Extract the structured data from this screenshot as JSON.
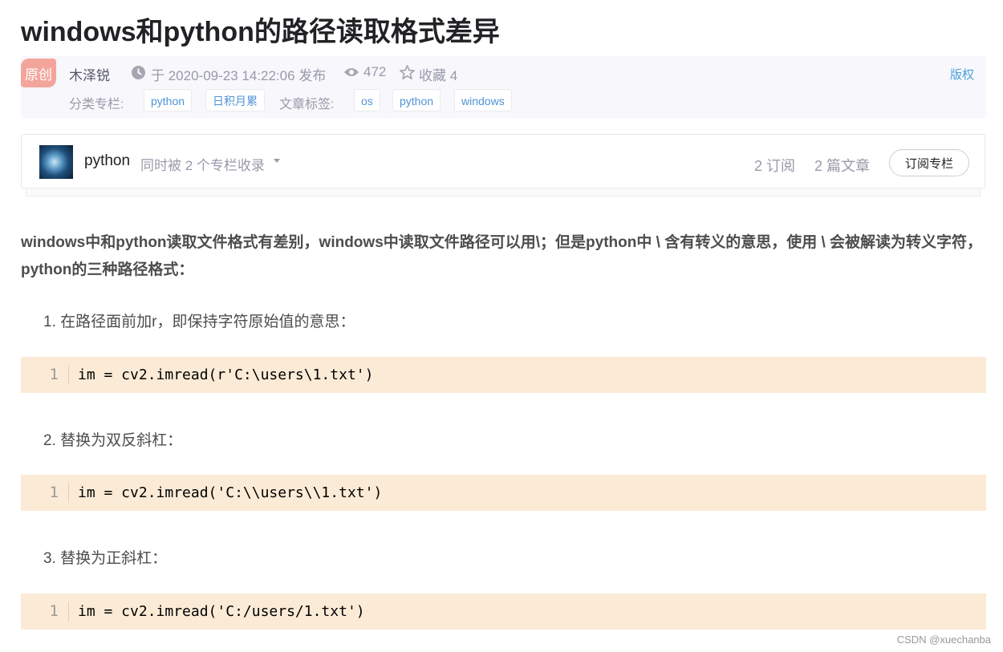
{
  "article": {
    "title": "windows和python的路径读取格式差异",
    "badge": "原创",
    "author": "木泽锐",
    "publish": "于 2020-09-23 14:22:06 发布",
    "views": "472",
    "favorites": "收藏 4",
    "copyright": "版权",
    "category_label": "分类专栏:",
    "categories": [
      "python",
      "日积月累"
    ],
    "tags_label": "文章标签:",
    "tags": [
      "os",
      "python",
      "windows"
    ]
  },
  "column": {
    "name": "python",
    "included": "同时被 2 个专栏收录",
    "subscribers": "2 订阅",
    "articles": "2 篇文章",
    "subscribe_button": "订阅专栏"
  },
  "content": {
    "intro": "windows中和python读取文件格式有差别，windows中读取文件路径可以用\\；但是python中 \\ 含有转义的意思，使用 \\ 会被解读为转义字符，python的三种路径格式：",
    "steps": [
      {
        "text": "1. 在路径面前加r，即保持字符原始值的意思：",
        "line": "1",
        "code": "im = cv2.imread(r'C:\\users\\1.txt')"
      },
      {
        "text": "2. 替换为双反斜杠：",
        "line": "1",
        "code": "im = cv2.imread('C:\\\\users\\\\1.txt')"
      },
      {
        "text": "3. 替换为正斜杠：",
        "line": "1",
        "code": "im = cv2.imread('C:/users/1.txt')"
      }
    ]
  },
  "watermark": "CSDN @xuechanba",
  "icons": {
    "clock": "clock-icon",
    "views": "eye-icon",
    "favorite": "star-icon",
    "dropdown": "caret-down-icon"
  },
  "colors": {
    "badge": "#f4a59b",
    "tag_text": "#5094d5",
    "code_bg": "#fbebd6",
    "meta_bg": "#f7f7fc"
  }
}
